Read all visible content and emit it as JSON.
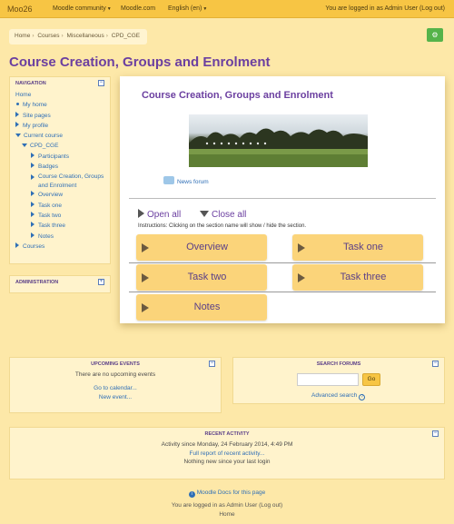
{
  "navbar": {
    "brand": "Moo26",
    "menus": [
      "Moodle community",
      "Moodle.com",
      "English (en)"
    ],
    "login_text": "You are logged in as Admin User (Log out)"
  },
  "breadcrumb": [
    "Home",
    "Courses",
    "Miscellaneous",
    "CPD_CGE"
  ],
  "page_title": "Course Creation, Groups and Enrolment",
  "navigation": {
    "title": "NAVIGATION",
    "home": "Home",
    "items": [
      {
        "label": "My home",
        "type": "dot"
      },
      {
        "label": "Site pages",
        "type": "collapsed"
      },
      {
        "label": "My profile",
        "type": "collapsed"
      },
      {
        "label": "Current course",
        "type": "expanded"
      }
    ],
    "course": "CPD_CGE",
    "course_items": [
      "Participants",
      "Badges",
      "Course Creation, Groups and Enrolment",
      "Overview",
      "Task one",
      "Task two",
      "Task three",
      "Notes"
    ],
    "courses": "Courses"
  },
  "administration": {
    "title": "ADMINISTRATION"
  },
  "main": {
    "title": "Course Creation, Groups and Enrolment",
    "news_forum": "News forum",
    "open_all": "Open all",
    "close_all": "Close all",
    "instructions": "Instructions: Clicking on the section name will show / hide the section.",
    "sections": [
      "Overview",
      "Task one",
      "Task two",
      "Task three",
      "Notes"
    ]
  },
  "upcoming": {
    "title": "UPCOMING EVENTS",
    "empty": "There are no upcoming events",
    "calendar": "Go to calendar...",
    "new_event": "New event..."
  },
  "search": {
    "title": "SEARCH FORUMS",
    "go": "Go",
    "advanced": "Advanced search"
  },
  "recent": {
    "title": "RECENT ACTIVITY",
    "since": "Activity since Monday, 24 February 2014, 4:49 PM",
    "report": "Full report of recent activity...",
    "nothing": "Nothing new since your last login"
  },
  "footer": {
    "docs": "Moodle Docs for this page",
    "login_text": "You are logged in as Admin User (Log out)",
    "home": "Home"
  }
}
